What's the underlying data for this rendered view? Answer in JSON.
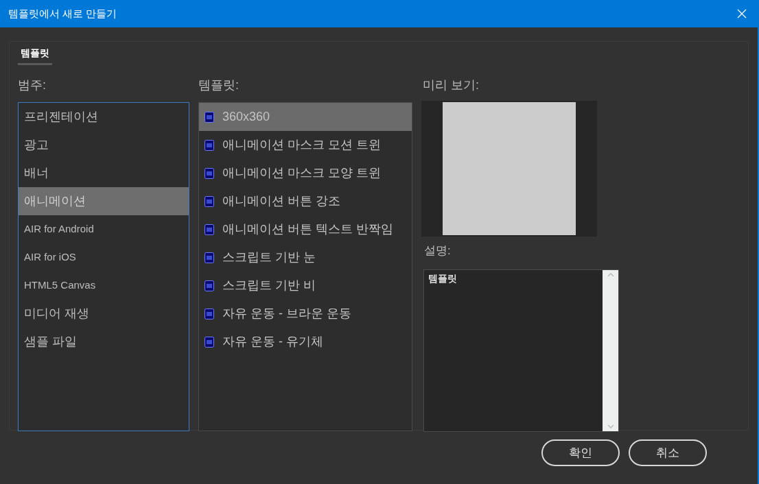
{
  "window": {
    "title": "템플릿에서 새로 만들기"
  },
  "tabs": [
    {
      "label": "템플릿",
      "selected": true
    }
  ],
  "categories": {
    "label": "범주:",
    "items": [
      {
        "label": "프리젠테이션",
        "selected": false
      },
      {
        "label": "광고",
        "selected": false
      },
      {
        "label": "배너",
        "selected": false
      },
      {
        "label": "애니메이션",
        "selected": true
      },
      {
        "label": "AIR for Android",
        "selected": false
      },
      {
        "label": "AIR for iOS",
        "selected": false
      },
      {
        "label": "HTML5 Canvas",
        "selected": false
      },
      {
        "label": "미디어 재생",
        "selected": false
      },
      {
        "label": "샘플 파일",
        "selected": false
      }
    ]
  },
  "templates": {
    "label": "템플릿:",
    "items": [
      {
        "label": "360x360",
        "selected": true
      },
      {
        "label": "애니메이션 마스크 모션 트윈",
        "selected": false
      },
      {
        "label": "애니메이션 마스크 모양 트윈",
        "selected": false
      },
      {
        "label": "애니메이션 버튼 강조",
        "selected": false
      },
      {
        "label": "애니메이션 버튼 텍스트 반짝임",
        "selected": false
      },
      {
        "label": "스크립트 기반 눈",
        "selected": false
      },
      {
        "label": "스크립트 기반 비",
        "selected": false
      },
      {
        "label": "자유 운동 - 브라운 운동",
        "selected": false
      },
      {
        "label": "자유 운동 - 유기체",
        "selected": false
      }
    ]
  },
  "preview": {
    "label": "미리 보기:"
  },
  "description": {
    "label": "설명:",
    "text": "템플릿"
  },
  "buttons": [
    "확인",
    "취소"
  ]
}
